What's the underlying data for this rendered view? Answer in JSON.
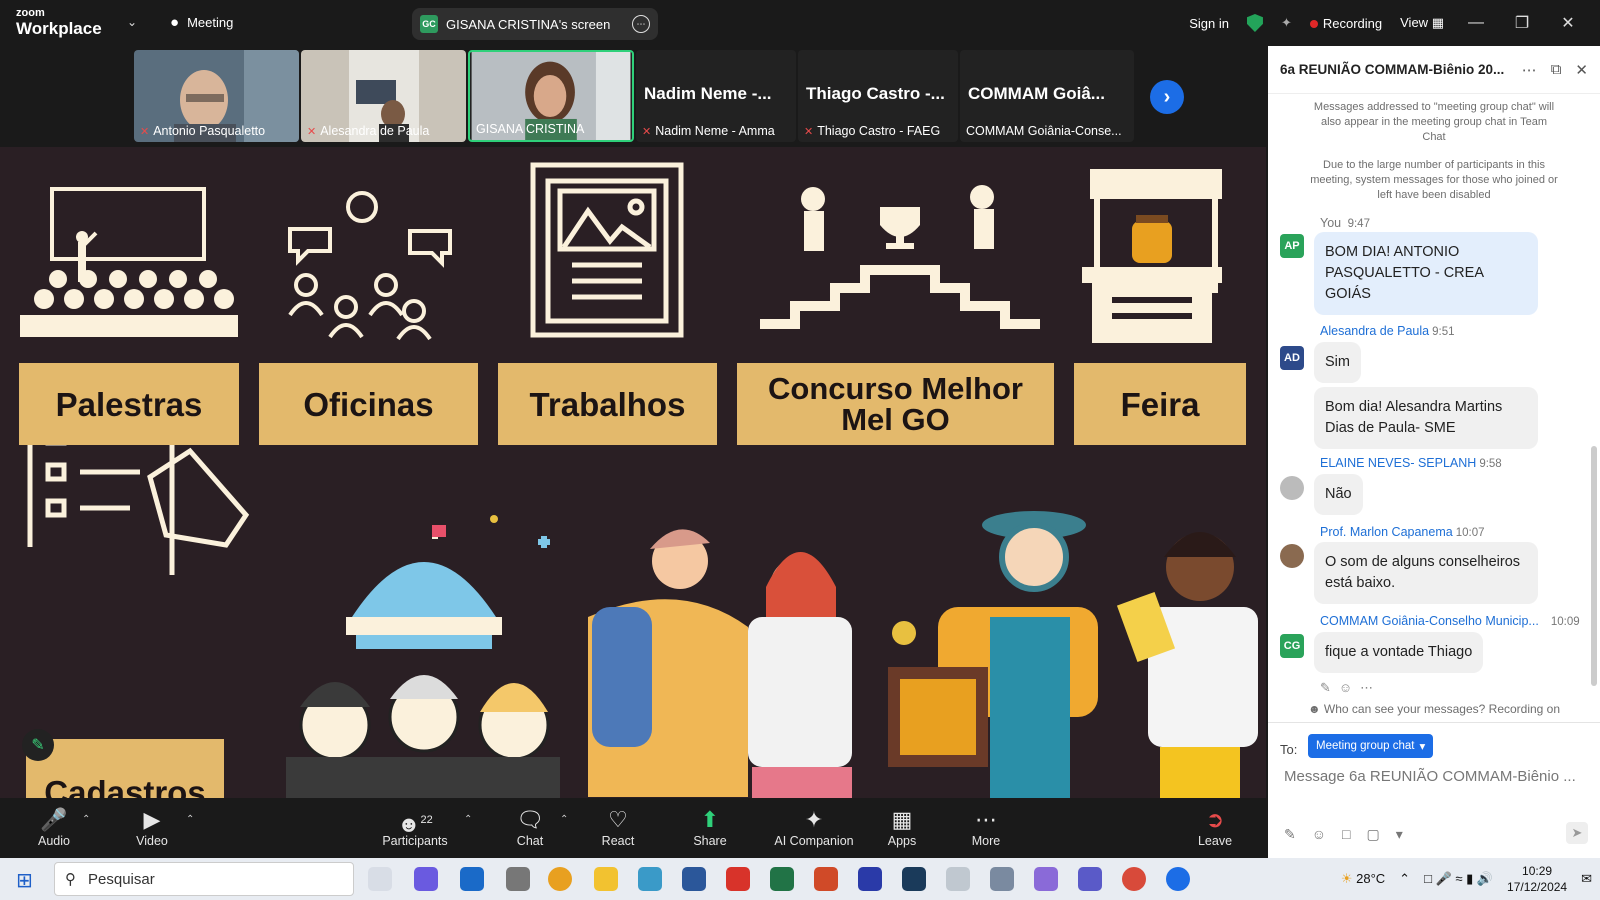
{
  "app": {
    "logo_small": "zoom",
    "logo_big": "Workplace",
    "meeting_label": "Meeting",
    "share_initials": "GC",
    "share_title": "GISANA CRISTINA's screen",
    "sign_in": "Sign in",
    "recording": "Recording",
    "view": "View"
  },
  "participants": [
    {
      "name": "Antonio Pasqualetto",
      "muted": true,
      "video": true
    },
    {
      "name": "Alesandra de Paula",
      "muted": true,
      "video": true
    },
    {
      "name": "GISANA CRISTINA",
      "muted": false,
      "video": true,
      "active": true
    },
    {
      "name": "Nadim Neme - Amma",
      "big": "Nadim Neme -...",
      "muted": true
    },
    {
      "name": "Thiago Castro - FAEG",
      "big": "Thiago Castro -...",
      "muted": true
    },
    {
      "name": "COMMAM Goiânia-Conse...",
      "big": "COMMAM Goiâ...",
      "muted": false
    }
  ],
  "slide": {
    "labels": [
      "Palestras",
      "Oficinas",
      "Trabalhos",
      "Concurso Melhor Mel GO",
      "Feira",
      "Cadastros"
    ],
    "colors": {
      "background": "#2a1f24",
      "label": "#e3b96c",
      "icon": "#fbf1dc"
    }
  },
  "chat": {
    "title": "6a REUNIÃO COMMAM-Biênio 20...",
    "sys1": "Messages addressed to \"meeting group chat\" will also appear in the meeting group chat in Team Chat",
    "sys2": "Due to the large number of participants in this meeting, system messages for those who joined or left have been disabled",
    "messages": [
      {
        "sender": "You",
        "time": "9:47",
        "initials": "AP",
        "text": "BOM DIA! ANTONIO PASQUALETTO - CREA GOIÁS"
      },
      {
        "sender": "Alesandra de Paula",
        "time": "9:51",
        "initials": "AD",
        "text": "Sim"
      },
      {
        "sender": "",
        "time": "",
        "initials": "",
        "text": "Bom dia! Alesandra Martins Dias de Paula- SME"
      },
      {
        "sender": "ELAINE NEVES- SEPLANH",
        "time": "9:58",
        "initials": "",
        "text": "Não"
      },
      {
        "sender": "Prof. Marlon Capanema",
        "time": "10:07",
        "initials": "",
        "text": "O som de alguns conselheiros está baixo."
      },
      {
        "sender": "COMMAM Goiânia-Conselho Municip...",
        "time": "10:09",
        "initials": "CG",
        "text": "fique a vontade Thiago"
      }
    ],
    "privacy": "Who can see your messages? Recording on",
    "to_label": "To:",
    "to_value": "Meeting group chat",
    "input_placeholder": "Message 6a REUNIÃO COMMAM-Biênio ..."
  },
  "toolbar": {
    "audio": "Audio",
    "video": "Video",
    "participants": "Participants",
    "participants_count": "22",
    "chat": "Chat",
    "react": "React",
    "share": "Share",
    "ai": "AI Companion",
    "apps": "Apps",
    "more": "More",
    "leave": "Leave"
  },
  "taskbar": {
    "search": "Pesquisar",
    "weather": "28°C",
    "time": "10:29",
    "date": "17/12/2024"
  }
}
